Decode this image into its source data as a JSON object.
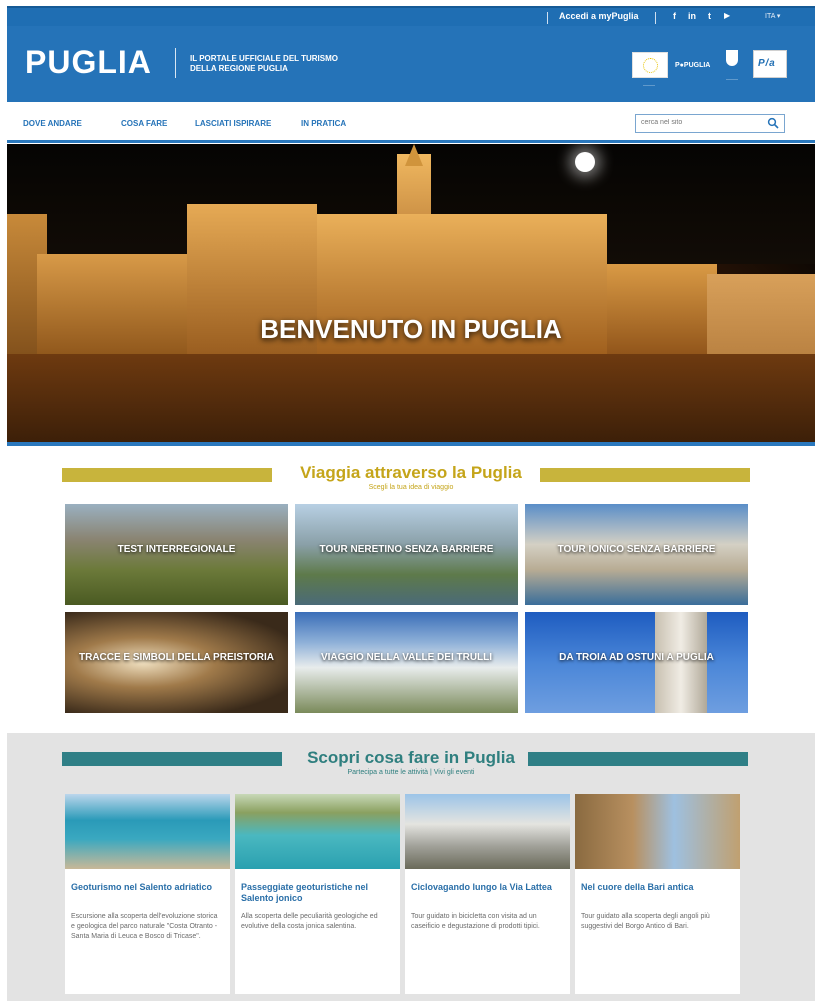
{
  "topbar": {
    "login": "Accedi a myPuglia",
    "social": [
      "f",
      "in",
      "t",
      "▶"
    ],
    "lang": "ITA ▾"
  },
  "header": {
    "logo": "PUGLIA",
    "tagline_line1": "IL PORTALE UFFICIALE DEL TURISMO",
    "tagline_line2": "DELLA REGIONE PUGLIA",
    "partner_puglia": "P●PUGLIA"
  },
  "nav": {
    "items": [
      "DOVE ANDARE",
      "COSA FARE",
      "LASCIATI ISPIRARE",
      "IN PRATICA"
    ],
    "search_placeholder": "cerca nel sito"
  },
  "hero": {
    "title": "BENVENUTO IN PUGLIA"
  },
  "section1": {
    "title": "Viaggia attraverso la Puglia",
    "subtitle": "Scegli la tua idea di viaggio",
    "accent": "#c8b43c",
    "tiles": [
      "TEST INTERREGIONALE",
      "TOUR NERETINO SENZA BARRIERE",
      "TOUR IONICO SENZA BARRIERE",
      "TRACCE E SIMBOLI DELLA PREISTORIA",
      "VIAGGIO NELLA VALLE DEI TRULLI",
      "DA TROIA AD OSTUNI A PUGLIA"
    ]
  },
  "section2": {
    "title": "Scopri cosa fare in Puglia",
    "subtitle": "Partecipa a tutte le attività | Vivi gli eventi",
    "accent": "#2f7f86",
    "cards": [
      {
        "title": "Geoturismo nel Salento adriatico",
        "desc": "Escursione alla scoperta dell'evoluzione storica e geologica del parco naturale \"Costa Otranto - Santa Maria di Leuca e Bosco di Tricase\"."
      },
      {
        "title": "Passeggiate geoturistiche nel Salento jonico",
        "desc": "Alla scoperta delle peculiarità geologiche ed evolutive della costa jonica salentina."
      },
      {
        "title": "Ciclovagando lungo la Via Lattea",
        "desc": "Tour guidato in bicicletta con visita ad un caseificio e degustazione di prodotti tipici."
      },
      {
        "title": "Nel cuore della Bari antica",
        "desc": "Tour guidato alla scoperta degli angoli più suggestivi del Borgo Antico di Bari."
      }
    ]
  }
}
